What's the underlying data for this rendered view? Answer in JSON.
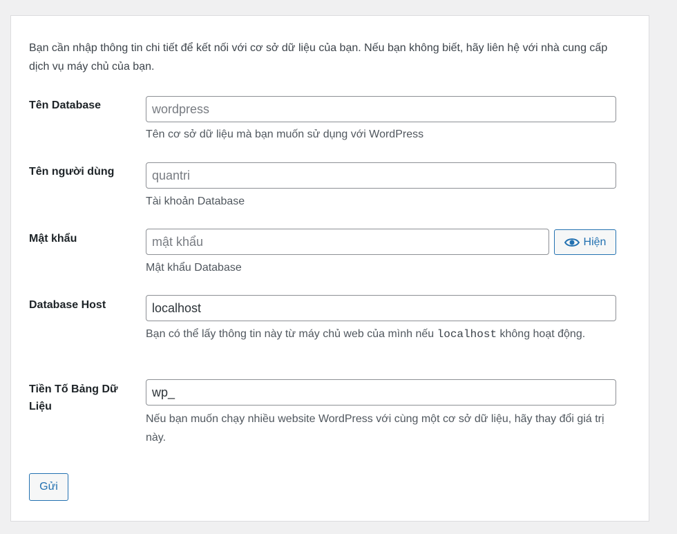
{
  "intro": "Bạn cần nhập thông tin chi tiết để kết nối với cơ sở dữ liệu của bạn. Nếu bạn không biết, hãy liên hệ với nhà cung cấp dịch vụ máy chủ của bạn.",
  "fields": {
    "dbname": {
      "label": "Tên Database",
      "placeholder": "wordpress",
      "value": "",
      "help": "Tên cơ sở dữ liệu mà bạn muốn sử dụng với WordPress"
    },
    "username": {
      "label": "Tên người dùng",
      "placeholder": "quantri",
      "value": "",
      "help": "Tài khoản Database"
    },
    "password": {
      "label": "Mật khẩu",
      "placeholder": "mật khẩu",
      "value": "",
      "help": "Mật khẩu Database",
      "show_label": "Hiện",
      "show_icon": "eye-icon"
    },
    "dbhost": {
      "label": "Database Host",
      "placeholder": "",
      "value": "localhost",
      "help_before": "Bạn có thể lấy thông tin này từ máy chủ web của mình nếu ",
      "help_code": "localhost",
      "help_after": " không hoạt động."
    },
    "prefix": {
      "label": "Tiền Tố Bảng Dữ Liệu",
      "placeholder": "",
      "value": "wp_",
      "help": "Nếu bạn muốn chạy nhiều website WordPress với cùng một cơ sở dữ liệu, hãy thay đổi giá trị này."
    }
  },
  "submit_label": "Gửi",
  "colors": {
    "accent": "#2271b1",
    "background": "#f0f0f1",
    "border": "#8c8f94"
  }
}
